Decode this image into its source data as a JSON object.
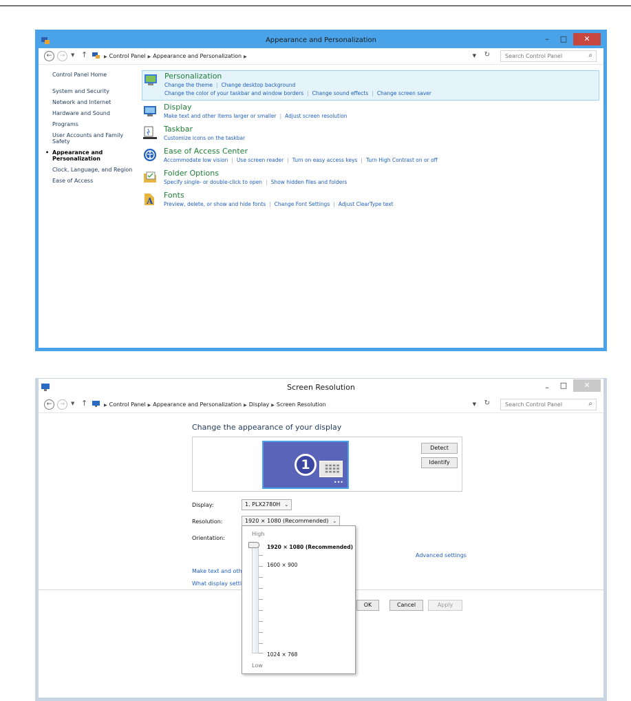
{
  "window1": {
    "title": "Appearance and Personalization",
    "breadcrumb": [
      "Control Panel",
      "Appearance and Personalization"
    ],
    "search_placeholder": "Search Control Panel",
    "sidebar": {
      "home": "Control Panel Home",
      "items": [
        "System and Security",
        "Network and Internet",
        "Hardware and Sound",
        "Programs",
        "User Accounts and Family Safety",
        "Appearance and Personalization",
        "Clock, Language, and Region",
        "Ease of Access"
      ],
      "active_index": 5
    },
    "categories": [
      {
        "title": "Personalization",
        "icon": "personalization-icon",
        "lines": [
          [
            "Change the theme",
            "Change desktop background"
          ],
          [
            "Change the color of your taskbar and window borders",
            "Change sound effects",
            "Change screen saver"
          ]
        ]
      },
      {
        "title": "Display",
        "icon": "display-icon",
        "lines": [
          [
            "Make text and other items larger or smaller",
            "Adjust screen resolution"
          ]
        ]
      },
      {
        "title": "Taskbar",
        "icon": "taskbar-icon",
        "lines": [
          [
            "Customize icons on the taskbar"
          ]
        ]
      },
      {
        "title": "Ease of Access Center",
        "icon": "ease-of-access-icon",
        "lines": [
          [
            "Accommodate low vision",
            "Use screen reader",
            "Turn on easy access keys",
            "Turn High Contrast on or off"
          ]
        ]
      },
      {
        "title": "Folder Options",
        "icon": "folder-options-icon",
        "lines": [
          [
            "Specify single- or double-click to open",
            "Show hidden files and folders"
          ]
        ]
      },
      {
        "title": "Fonts",
        "icon": "fonts-icon",
        "lines": [
          [
            "Preview, delete, or show and hide fonts",
            "Change Font Settings",
            "Adjust ClearType text"
          ]
        ]
      }
    ]
  },
  "window2": {
    "title": "Screen Resolution",
    "breadcrumb": [
      "Control Panel",
      "Appearance and Personalization",
      "Display",
      "Screen Resolution"
    ],
    "search_placeholder": "Search Control Panel",
    "heading": "Change the appearance of your display",
    "monitor_number": "1",
    "detect": "Detect",
    "identify": "Identify",
    "display_label": "Display:",
    "display_value": "1. PLX2780H",
    "resolution_label": "Resolution:",
    "resolution_value": "1920 × 1080 (Recommended)",
    "orientation_label": "Orientation:",
    "advanced_settings": "Advanced settings",
    "link1": "Make text and other",
    "link2": "What display setting",
    "ok": "OK",
    "cancel": "Cancel",
    "apply": "Apply",
    "popup": {
      "high": "High",
      "low": "Low",
      "options": [
        "1920 × 1080 (Recommended)",
        "1600 × 900",
        "1024 × 768"
      ],
      "selected": 0
    }
  },
  "colors": {
    "accent": "#4aa3e8",
    "close": "#c7463f",
    "link": "#1f5fbf",
    "category_title": "#1e7e34"
  }
}
